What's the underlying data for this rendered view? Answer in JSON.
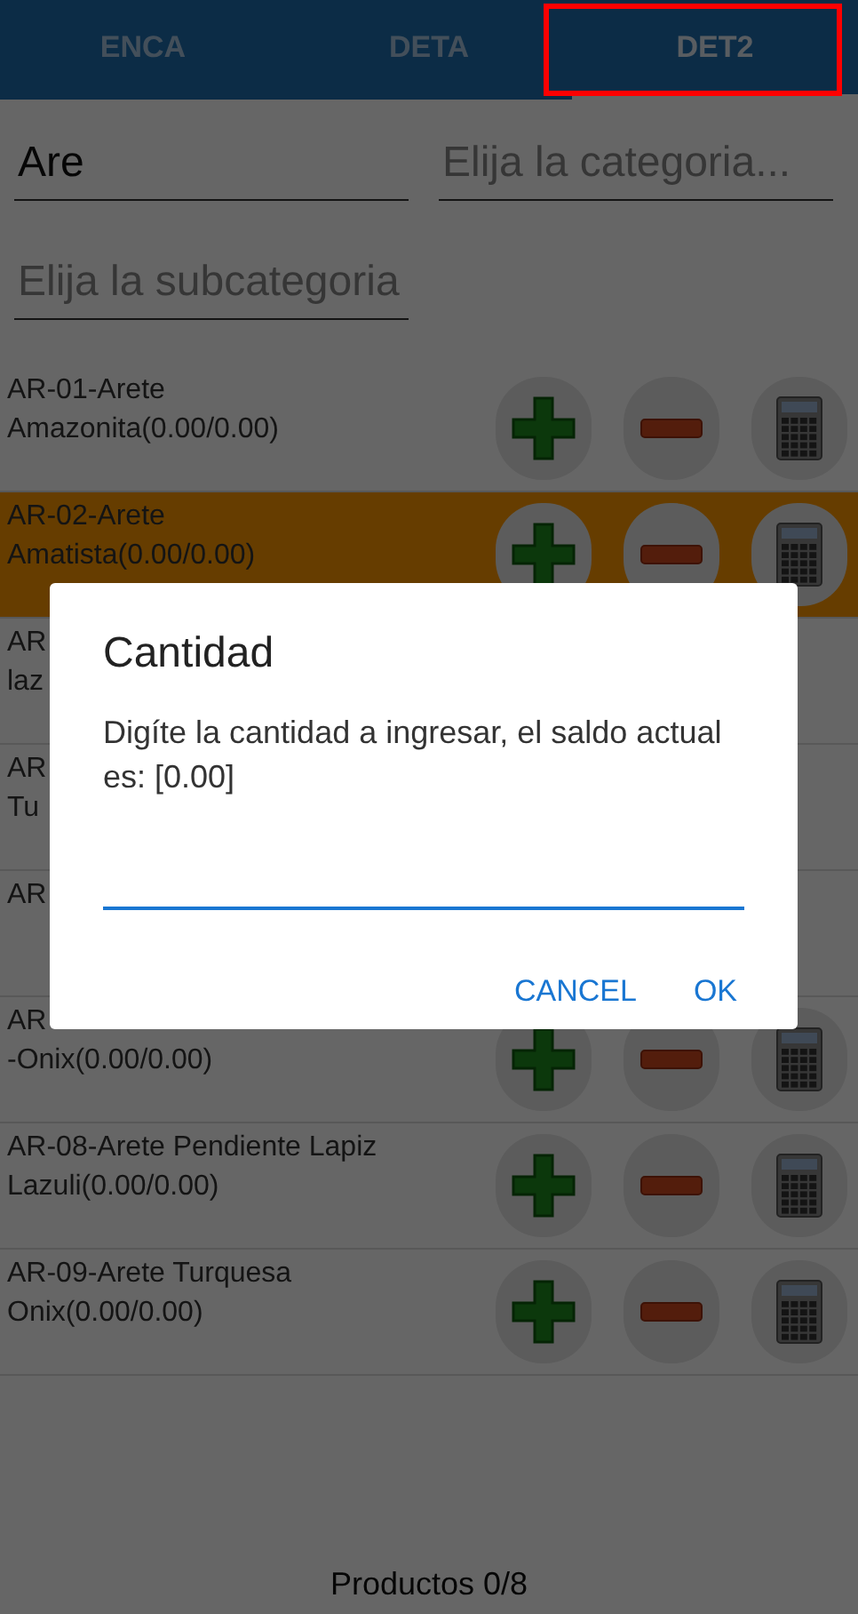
{
  "tabs": [
    {
      "label": "ENCA",
      "selected": false
    },
    {
      "label": "DETA",
      "selected": false
    },
    {
      "label": "DET2",
      "selected": true
    }
  ],
  "search": {
    "value": "Are"
  },
  "category": {
    "placeholder": "Elija la categoria..."
  },
  "subcategory": {
    "placeholder": "Elija la subcategoria"
  },
  "products": [
    {
      "lines": [
        "AR-01-Arete",
        "Amazonita(0.00/0.00)"
      ],
      "selected": false,
      "actions": true
    },
    {
      "lines": [
        "AR-02-Arete",
        "Amatista(0.00/0.00)"
      ],
      "selected": true,
      "actions": true
    },
    {
      "lines": [
        "AR",
        "laz"
      ],
      "selected": false,
      "actions": false
    },
    {
      "lines": [
        "AR",
        "Tu"
      ],
      "selected": false,
      "actions": false
    },
    {
      "lines": [
        "AR"
      ],
      "selected": false,
      "actions": false
    },
    {
      "lines": [
        "AR",
        "-Onix(0.00/0.00)"
      ],
      "selected": false,
      "actions": true
    },
    {
      "lines": [
        "AR-08-Arete Pendiente Lapiz",
        "Lazuli(0.00/0.00)"
      ],
      "selected": false,
      "actions": true
    },
    {
      "lines": [
        "AR-09-Arete Turquesa",
        "Onix(0.00/0.00)"
      ],
      "selected": false,
      "actions": true
    }
  ],
  "footer": "Productos 0/8",
  "dialog": {
    "title": "Cantidad",
    "message": "Digíte la cantidad a ingresar, el saldo actual es: [0.00]",
    "buttons": [
      "CANCEL",
      "OK"
    ]
  }
}
